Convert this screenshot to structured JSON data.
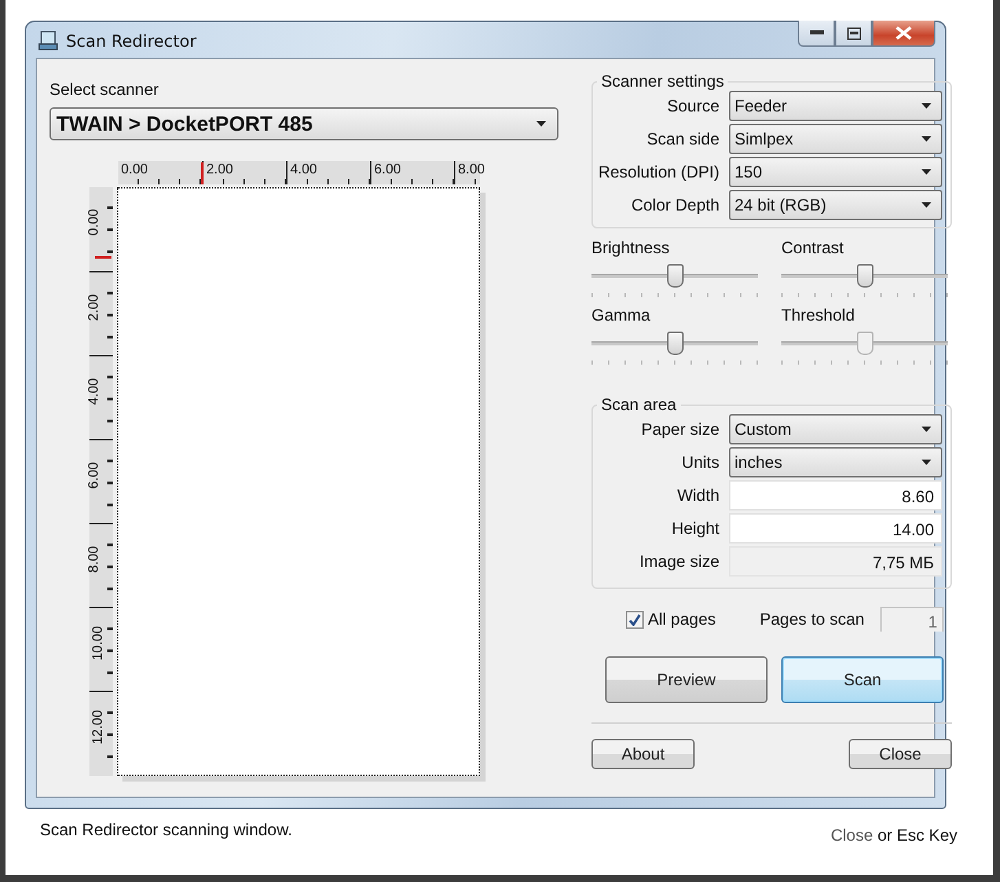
{
  "window": {
    "title": "Scan Redirector"
  },
  "scanner": {
    "label": "Select scanner",
    "value": "TWAIN > DocketPORT 485"
  },
  "preview": {
    "h_ruler": {
      "labels": [
        "0.00",
        "2.00",
        "4.00",
        "6.00",
        "8.00"
      ],
      "level": 0.227
    },
    "v_ruler": {
      "labels": [
        "0.00",
        "2.00",
        "4.00",
        "6.00",
        "8.00",
        "10.00",
        "12.00"
      ],
      "level": 0.117
    }
  },
  "settings": {
    "title": "Scanner settings",
    "fields": [
      {
        "label": "Source",
        "value": "Feeder",
        "kind": "select"
      },
      {
        "label": "Scan side",
        "value": "Simlpex",
        "kind": "select"
      },
      {
        "label": "Resolution (DPI)",
        "value": "150",
        "kind": "select"
      },
      {
        "label": "Color Depth",
        "value": "24 bit (RGB)",
        "kind": "select"
      }
    ]
  },
  "sliders": [
    {
      "label": "Brightness",
      "level": 0.5,
      "disabled": false
    },
    {
      "label": "Contrast",
      "level": 0.5,
      "disabled": false
    },
    {
      "label": "Gamma",
      "level": 0.5,
      "disabled": false
    },
    {
      "label": "Threshold",
      "level": 0.5,
      "disabled": true
    }
  ],
  "scan_area": {
    "title": "Scan area",
    "fields": [
      {
        "label": "Paper size",
        "value": "Custom",
        "kind": "select"
      },
      {
        "label": "Units",
        "value": "inches",
        "kind": "select"
      },
      {
        "label": "Width",
        "value": "8.60",
        "kind": "input"
      },
      {
        "label": "Height",
        "value": "14.00",
        "kind": "input"
      },
      {
        "label": "Image size",
        "value": "7,75 МБ",
        "kind": "readonly"
      }
    ]
  },
  "pages": {
    "all_pages": {
      "label": "All pages",
      "checked": true
    },
    "pages_to_scan": {
      "label": "Pages to scan",
      "value": "1",
      "disabled": true
    }
  },
  "actions": [
    {
      "label": "Preview",
      "default": false
    },
    {
      "label": "Scan",
      "default": true
    }
  ],
  "footer_buttons": [
    "About",
    "Close"
  ],
  "caption": "Scan Redirector scanning window.",
  "hint": {
    "link": "Close",
    "text": "or Esc Key"
  }
}
